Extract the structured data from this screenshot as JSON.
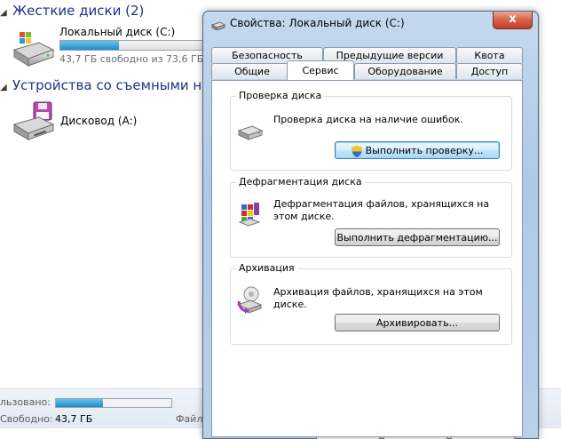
{
  "explorer": {
    "hard_disks_header": "Жесткие диски (2)",
    "removable_header": "Устройства со съемными носи",
    "local_disk": {
      "name": "Локальный диск (C:)",
      "free_text": "43,7 ГБ свободно из 73,6 ГБ",
      "used_fraction": 0.41
    },
    "floppy": {
      "name": "Дисковод (A:)"
    },
    "details": {
      "used_label": "льзовано:",
      "used_fraction": 0.41,
      "free_label": "Свободно:",
      "free_value": "43,7 ГБ",
      "fs_label_partial": "Файл"
    }
  },
  "dialog": {
    "title": "Свойства: Локальный диск (C:)",
    "close_glyph": "x",
    "tabs_row1": [
      "Безопасность",
      "Предыдущие версии",
      "Квота"
    ],
    "tabs_row2": [
      "Общие",
      "Сервис",
      "Оборудование",
      "Доступ"
    ],
    "active_tab": "Сервис",
    "check": {
      "title": "Проверка диска",
      "text": "Проверка диска на наличие ошибок.",
      "button": "Выполнить проверку..."
    },
    "defrag": {
      "title": "Дефрагментация диска",
      "text": "Дефрагментация файлов, хранящихся на этом диске.",
      "button": "Выполнить дефрагментацию..."
    },
    "backup": {
      "title": "Архивация",
      "text": "Архивация файлов, хранящихся на этом диске.",
      "button": "Архивировать..."
    }
  },
  "colors": {
    "header_text": "#1e3287",
    "progress_fill": "#1e8ec9",
    "close_button": "#c13f25"
  }
}
